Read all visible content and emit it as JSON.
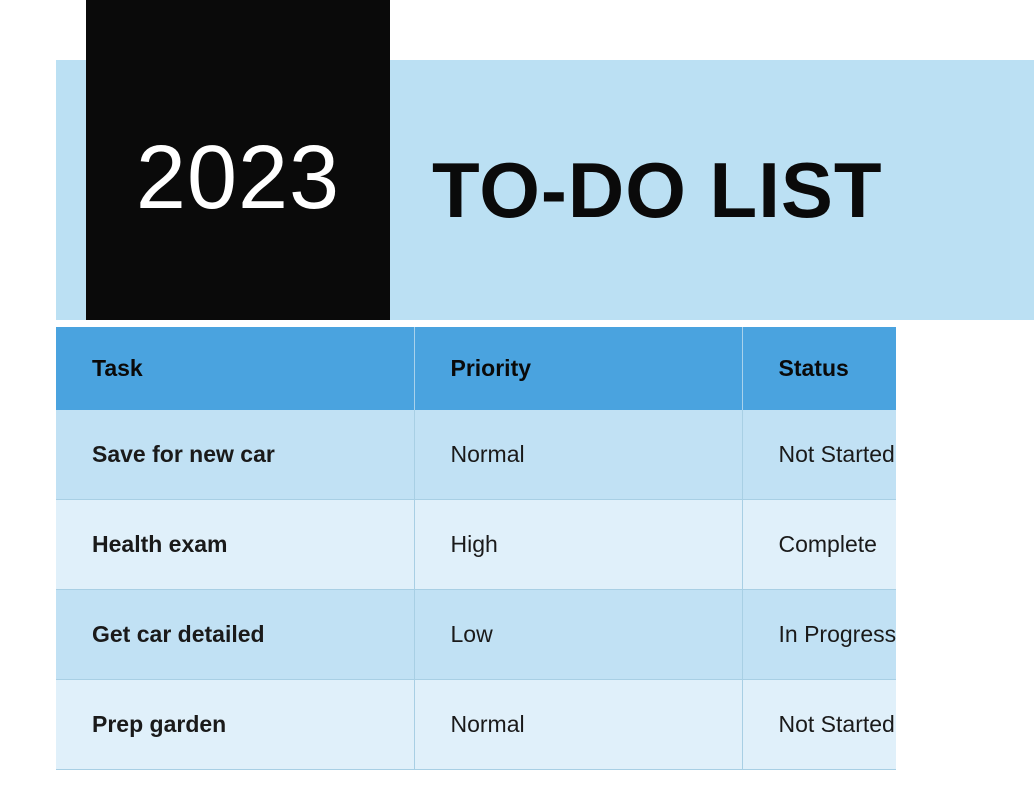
{
  "header": {
    "year": "2023",
    "title": "TO-DO LIST"
  },
  "table": {
    "columns": [
      "Task",
      "Priority",
      "Status"
    ],
    "rows": [
      {
        "task": "Save for new car",
        "priority": "Normal",
        "status": "Not Started"
      },
      {
        "task": "Health exam",
        "priority": "High",
        "status": "Complete"
      },
      {
        "task": "Get car detailed",
        "priority": "Low",
        "status": "In Progress"
      },
      {
        "task": "Prep garden",
        "priority": "Normal",
        "status": "Not Started"
      }
    ]
  },
  "colors": {
    "header_band": "#bbe0f3",
    "year_block": "#0a0a0a",
    "table_head": "#4aa3df",
    "row_odd": "#c1e1f4",
    "row_even": "#e0f0fa"
  }
}
